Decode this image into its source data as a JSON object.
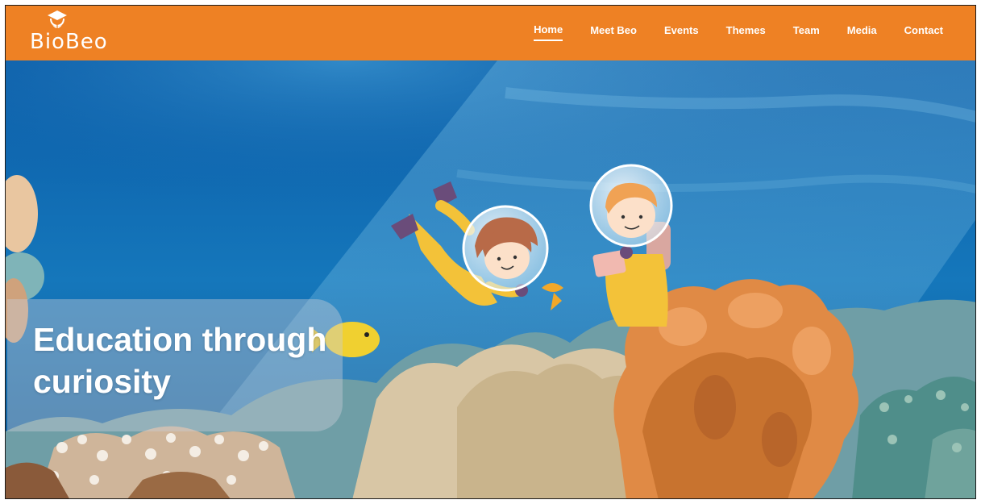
{
  "brand": {
    "name": "BioBeo",
    "logo_icon": "graduation-cap-leaf-icon",
    "color": "#ee8124"
  },
  "nav": {
    "items": [
      {
        "label": "Home",
        "active": true
      },
      {
        "label": "Meet Beo",
        "active": false
      },
      {
        "label": "Events",
        "active": false
      },
      {
        "label": "Themes",
        "active": false
      },
      {
        "label": "Team",
        "active": false
      },
      {
        "label": "Media",
        "active": false
      },
      {
        "label": "Contact",
        "active": false
      }
    ]
  },
  "hero": {
    "tagline": "Education through curiosity",
    "background": "underwater-coral-reef-illustration",
    "characters": [
      "diver-girl-swimming",
      "diver-boy-with-tablet"
    ],
    "colors": {
      "water_deep": "#0a4f93",
      "water_light": "#2a8fc9",
      "coral_orange": "#e08a45",
      "suit_yellow": "#f3c239"
    }
  }
}
